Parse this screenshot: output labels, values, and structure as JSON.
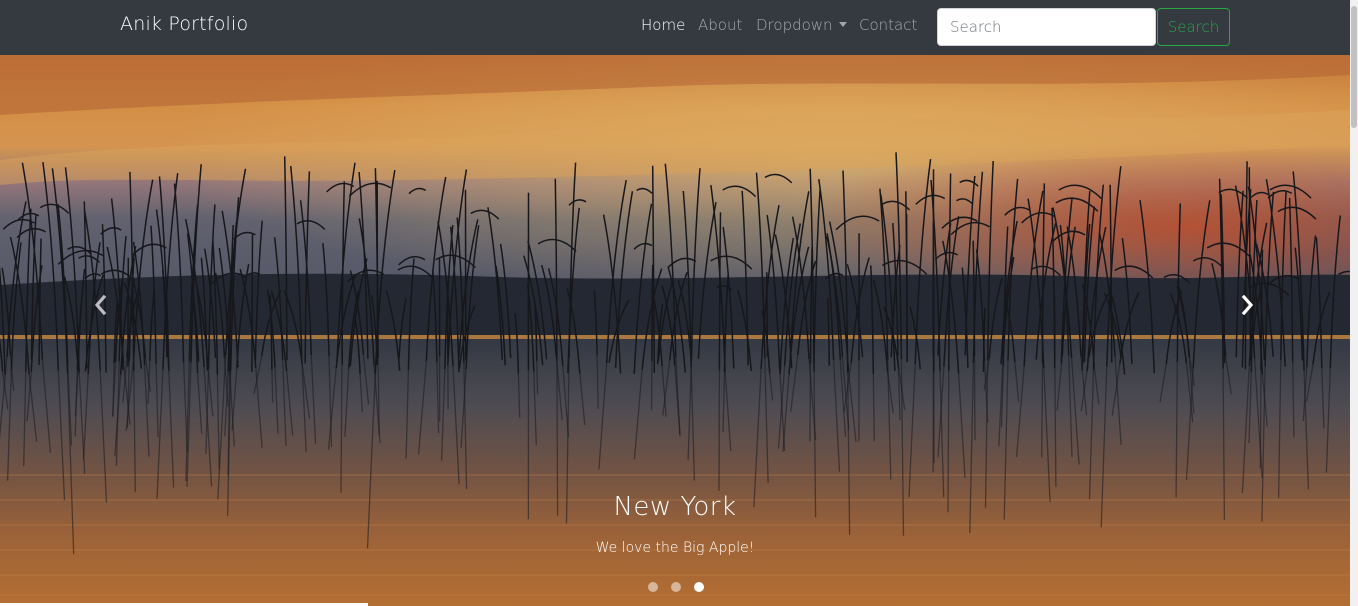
{
  "navbar": {
    "brand": "Anik Portfolio",
    "links": [
      {
        "label": "Home",
        "active": true
      },
      {
        "label": "About",
        "active": false
      },
      {
        "label": "Dropdown",
        "active": false
      },
      {
        "label": "Contact",
        "active": false
      }
    ],
    "search": {
      "placeholder": "Search",
      "value": "",
      "button_label": "Search"
    }
  },
  "carousel": {
    "caption_title": "New York",
    "caption_text": "We love the Big Apple!",
    "slide_count": 3,
    "active_slide": 3,
    "prev_icon": "chevron-left-icon",
    "next_icon": "chevron-right-icon"
  },
  "colors": {
    "navbar_bg": "#343a40",
    "search_button": "#28a745"
  }
}
